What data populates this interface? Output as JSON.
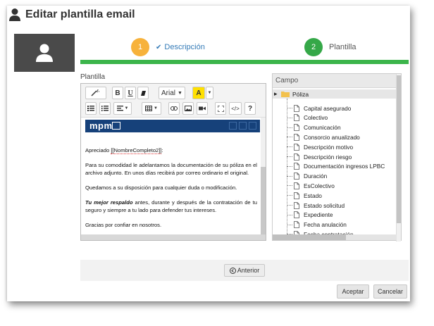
{
  "title": "Editar plantilla email",
  "wizard": {
    "step1": {
      "number": "1",
      "label": "Descripción"
    },
    "step2": {
      "number": "2",
      "label": "Plantilla"
    }
  },
  "editor_label": "Plantilla",
  "toolbar": {
    "font_name": "Arial",
    "bold": "B",
    "underline": "U",
    "highlight": "A",
    "help": "?",
    "code": "</>"
  },
  "mail": {
    "brand": "mpm",
    "greeting_prefix": "Apreciado ",
    "greeting_placeholder": "[[NombreCompleto2]]",
    "greeting_suffix": ":",
    "para1": "Para su comodidad le adelantamos la documentación de su póliza en el archivo adjunto. En unos días recibirá por correo ordinario el original.",
    "para2": "Quedamos a su disposición para cualquier duda o modificación.",
    "para3_emph": "Tu mejor respaldo",
    "para3_rest": " antes, durante y después de la contratación de tu seguro y siempre a tu lado para defender tus intereses.",
    "para4": "Gracias por confiar en nosotros."
  },
  "tree": {
    "header": "Campo",
    "root": "Póliza",
    "items": [
      "Capital asegurado",
      "Colectivo",
      "Comunicación",
      "Consorcio anualizado",
      "Descripción motivo",
      "Descripción riesgo",
      "Documentación ingresos LPBC",
      "Duración",
      "EsColectivo",
      "Estado",
      "Estado solicitud",
      "Expediente",
      "Fecha anulación",
      "Fecha contratación"
    ]
  },
  "buttons": {
    "previous": "Anterior",
    "accept": "Aceptar",
    "cancel": "Cancelar"
  },
  "colors": {
    "step1": "#f7b23b",
    "step2": "#35a848",
    "progress": "#3cb54b",
    "brand": "#16417a"
  }
}
